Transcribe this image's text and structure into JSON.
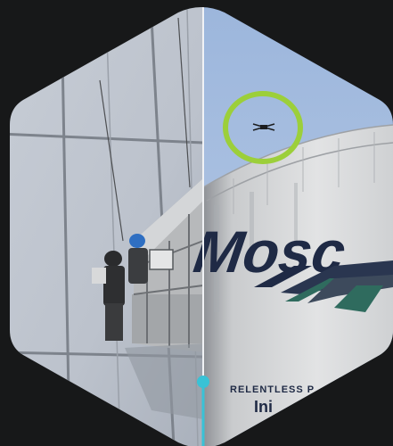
{
  "composite": {
    "left_panel": {
      "subject": "window washers on suspended platform against glass facade"
    },
    "right_panel": {
      "subject": "drone above white storage tank with company logo"
    }
  },
  "tank_logo": {
    "wordmark": "Mosc",
    "tagline": "RELENTLESS P",
    "sub_text": "Ini"
  },
  "colors": {
    "background": "#171819",
    "highlight_ring": "#9ccf3a",
    "divider_handle": "#39c2d6",
    "logo_navy": "#1f2a45",
    "logo_green": "#2f6b5e"
  },
  "icons": {
    "drone": "drone-icon",
    "handle": "slider-handle"
  }
}
